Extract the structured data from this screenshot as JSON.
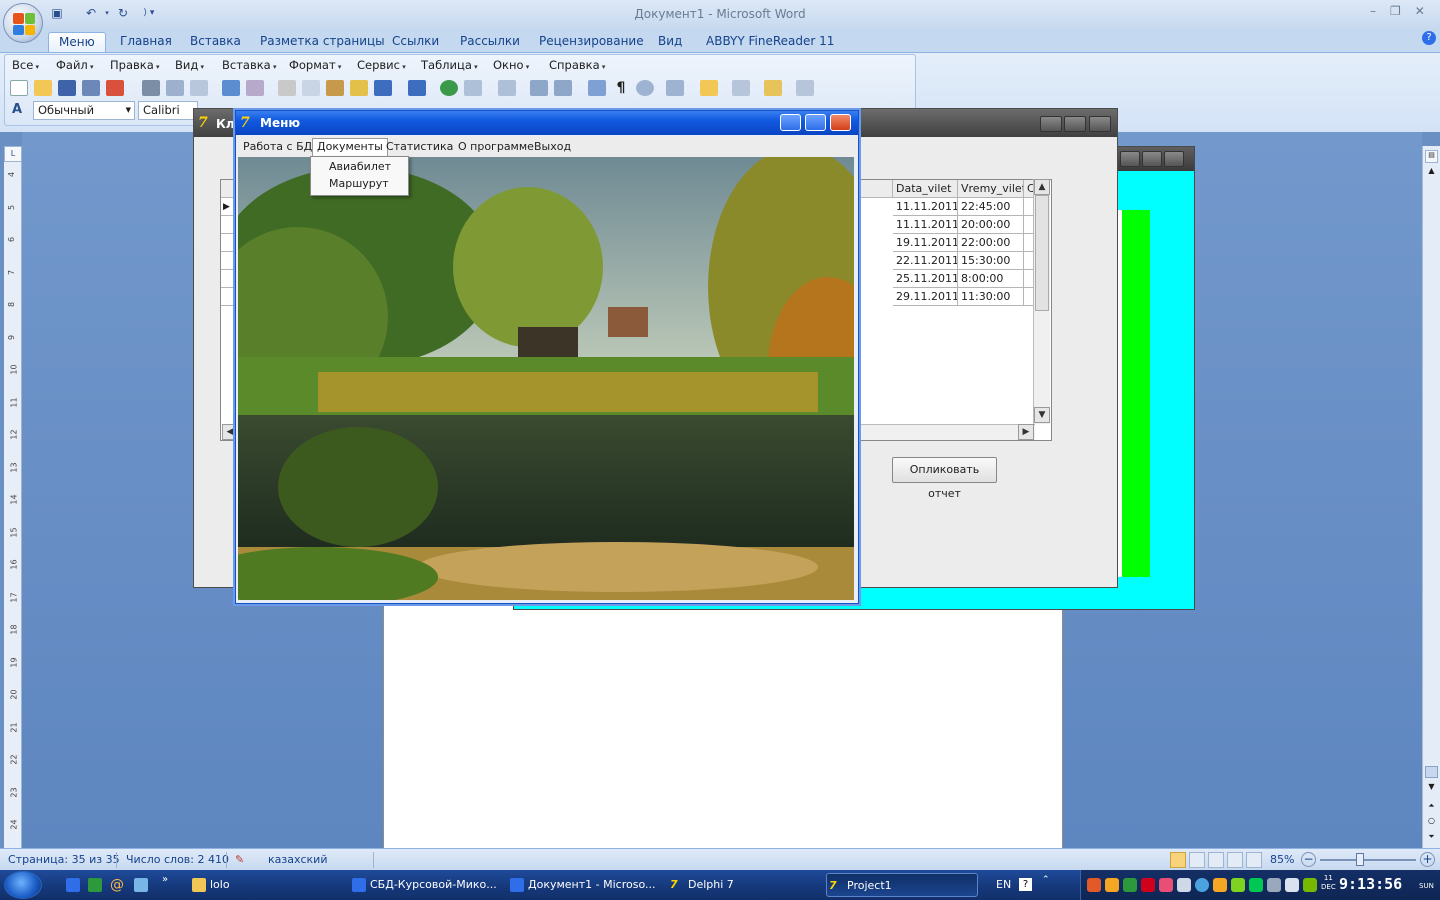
{
  "word": {
    "title": "Документ1 - Microsoft Word",
    "tabs": [
      "Меню",
      "Главная",
      "Вставка",
      "Разметка страницы",
      "Ссылки",
      "Рассылки",
      "Рецензирование",
      "Вид",
      "ABBYY FineReader 11"
    ],
    "classic_menu": [
      "Все",
      "Файл",
      "Правка",
      "Вид",
      "Вставка",
      "Формат",
      "Сервис",
      "Таблица",
      "Окно",
      "Справка"
    ],
    "style_value": "Обычный",
    "font_value": "Calibri (Ос",
    "ruler_numbers": [
      "4",
      "5",
      "6",
      "7",
      "8",
      "9",
      "10",
      "11",
      "12",
      "13",
      "14",
      "15",
      "16",
      "17",
      "18",
      "19",
      "20",
      "21",
      "22",
      "23",
      "24"
    ],
    "status": {
      "page": "Страница: 35 из 35",
      "words": "Число слов: 2 410",
      "language": "казахский",
      "zoom": "85%"
    }
  },
  "grey_window": {
    "title": "Кл",
    "grid": {
      "columns": [
        "Data_vilet",
        "Vremy_vilet",
        "C"
      ],
      "rows": [
        [
          "11.11.2011",
          "22:45:00"
        ],
        [
          "11.11.2011",
          "20:00:00"
        ],
        [
          "19.11.2011",
          "22:00:00"
        ],
        [
          "22.11.2011",
          "15:30:00"
        ],
        [
          "25.11.2011",
          "8:00:00"
        ],
        [
          "29.11.2011",
          "11:30:00"
        ]
      ]
    },
    "report_button": "Опликовать отчет"
  },
  "menu_window": {
    "title": "Меню",
    "menu": [
      "Работа с БД",
      "Документы",
      "Статистика",
      "О программе",
      "Выход"
    ],
    "dropdown": [
      "Авиабилет",
      "Маршурут"
    ]
  },
  "taskbar": {
    "items": [
      "lolo",
      "СБД-Курсовой-Мико...",
      "Документ1 - Microso...",
      "Delphi 7",
      "Project1"
    ],
    "lang": "EN",
    "clock_day": "11",
    "clock_month": "DEC",
    "clock_time": "9:13:56",
    "clock_weekday": "SUN"
  },
  "colors": {
    "ribbon_text": "#15428b",
    "xp_title": "#1159e0",
    "cyan_window": "#00ffff",
    "green_panel": "#00ff00"
  }
}
